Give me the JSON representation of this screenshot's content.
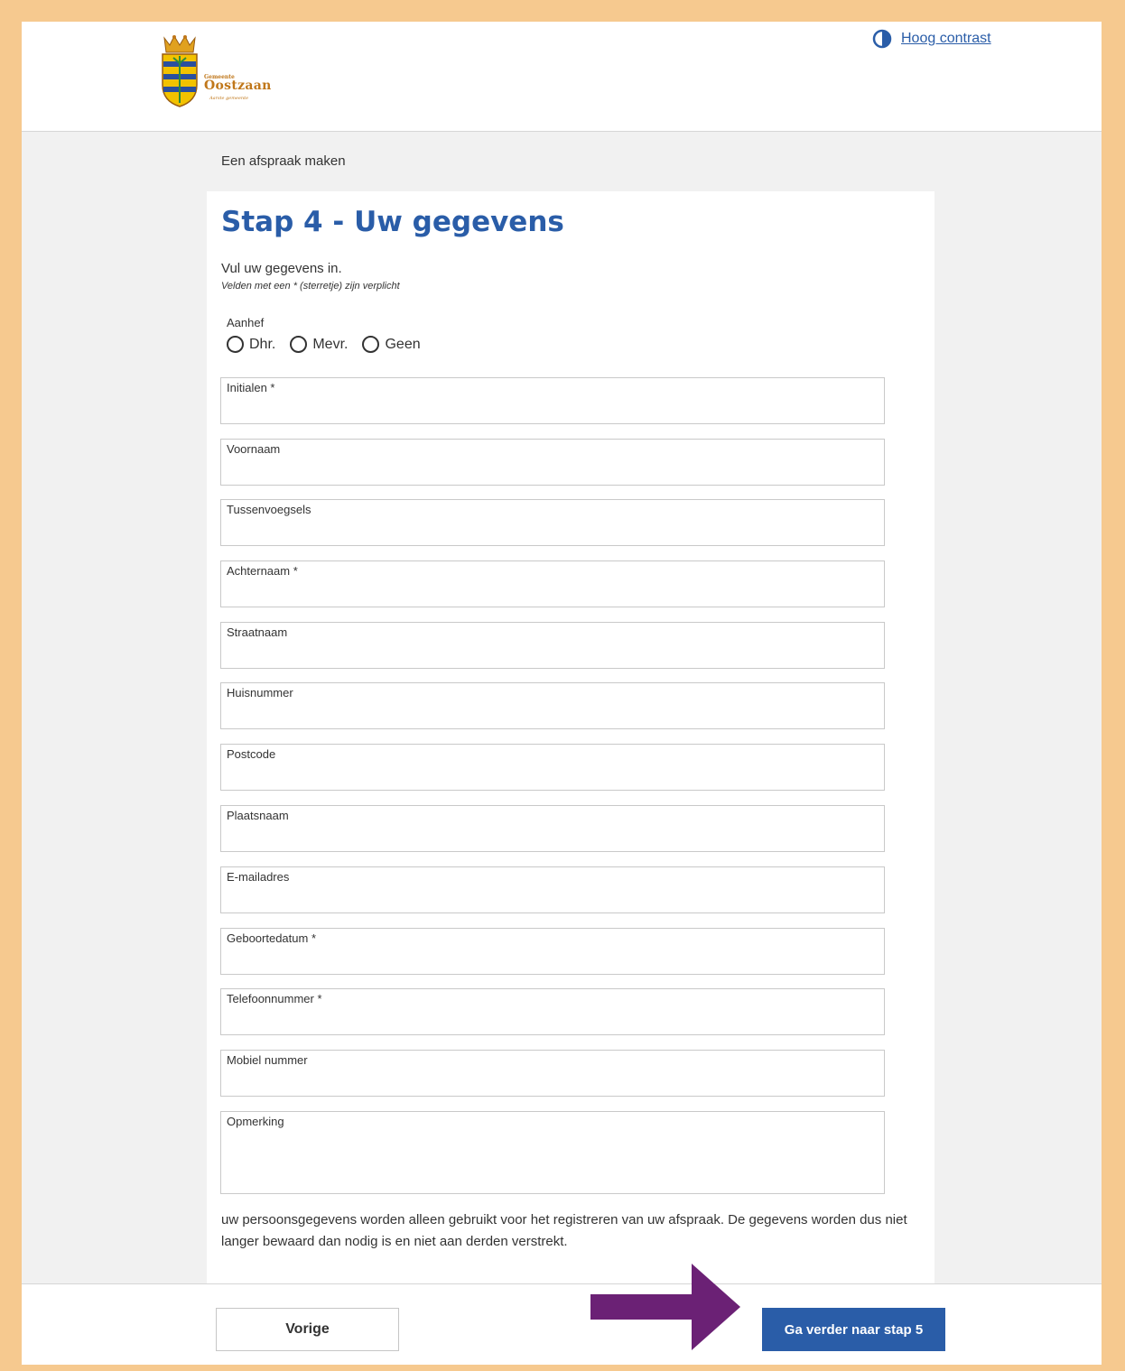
{
  "header": {
    "logo": {
      "line_top": "Gemeente",
      "line_main": "Oostzaan",
      "line_sub": "Aarste gemeente",
      "colors": {
        "gold": "#c0771a",
        "blue": "#2a4f9e",
        "yellow": "#f2c200"
      }
    },
    "contrast_label": "Hoog contrast"
  },
  "breadcrumb": "Een afspraak maken",
  "form": {
    "title": "Stap 4 - Uw gegevens",
    "intro": "Vul uw gegevens in.",
    "hint": "Velden met een * (sterretje) zijn verplicht",
    "aanhef": {
      "label": "Aanhef",
      "options": [
        "Dhr.",
        "Mevr.",
        "Geen"
      ]
    },
    "fields": [
      {
        "label": "Initialen *",
        "value": ""
      },
      {
        "label": "Voornaam",
        "value": ""
      },
      {
        "label": "Tussenvoegsels",
        "value": ""
      },
      {
        "label": "Achternaam *",
        "value": ""
      },
      {
        "label": "Straatnaam",
        "value": ""
      },
      {
        "label": "Huisnummer",
        "value": ""
      },
      {
        "label": "Postcode",
        "value": ""
      },
      {
        "label": "Plaatsnaam",
        "value": ""
      },
      {
        "label": "E-mailadres",
        "value": ""
      },
      {
        "label": "Geboortedatum *",
        "value": ""
      },
      {
        "label": "Telefoonnummer *",
        "value": ""
      },
      {
        "label": "Mobiel nummer",
        "value": ""
      },
      {
        "label": "Opmerking",
        "value": ""
      }
    ],
    "privacy": "uw persoonsgegevens worden alleen gebruikt voor het registreren van uw afspraak. De gegevens worden dus niet langer bewaard dan nodig is en niet aan derden verstrekt."
  },
  "footer": {
    "prev_label": "Vorige",
    "next_label": "Ga verder naar stap 5"
  },
  "colors": {
    "accent": "#2a5da8",
    "frame": "#f6c98f",
    "arrow": "#6b2175"
  }
}
